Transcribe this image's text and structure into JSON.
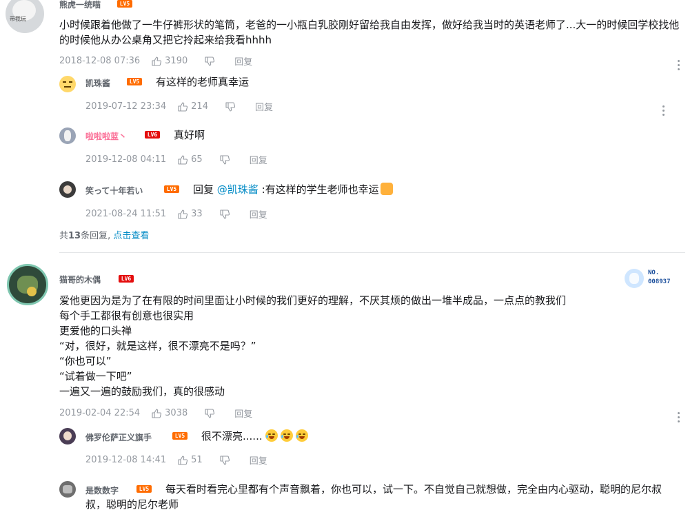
{
  "c1": {
    "username": "熊虎一统喵",
    "avatar_text": "带我玩",
    "level": "LV5",
    "text": "小时候跟着他做了一牛仔裤形状的笔筒，老爸的一小瓶白乳胶刚好留给我自由发挥，做好给我当时的英语老师了...大一的时候回学校找他的时候他从办公桌角又把它拎起来给我看hhhh",
    "date": "2018-12-08 07:36",
    "likes": "3190",
    "reply": "回复"
  },
  "c1r1": {
    "username": "凯珠酱",
    "level": "LV5",
    "text": "有这样的老师真幸运",
    "date": "2019-07-12 23:34",
    "likes": "214",
    "reply": "回复"
  },
  "c1r2": {
    "username": "啦啦啦蓝丶",
    "level": "LV6",
    "text": "真好啊",
    "date": "2019-12-08 04:11",
    "likes": "65",
    "reply": "回复"
  },
  "c1r3": {
    "username": "笑って十年若い",
    "level": "LV5",
    "prefix": "回复 ",
    "mention": "@凯珠酱",
    "text": " :有这样的学生老师也幸运",
    "date": "2021-08-24 11:51",
    "likes": "33",
    "reply": "回复"
  },
  "c1_more": {
    "pre": "共",
    "count": "13",
    "mid": "条回复, ",
    "link": "点击查看"
  },
  "c2": {
    "username": "猫哥的木偶",
    "level": "LV6",
    "badge_no": "NO.",
    "badge_num": "008937",
    "lines": [
      "爱他更因为是为了在有限的时间里面让小时候的我们更好的理解，不厌其烦的做出一堆半成品，一点点的教我们",
      "每个手工都很有创意也很实用",
      "更爱他的口头禅",
      "“对，很好，就是这样，很不漂亮不是吗？”",
      "“你也可以”",
      "“试着做一下吧”",
      "一遍又一遍的鼓励我们，真的很感动"
    ],
    "date": "2019-02-04 22:54",
    "likes": "3038",
    "reply": "回复"
  },
  "c2r1": {
    "username": "佛罗伦萨正义旗手",
    "level": "LV5",
    "text": "很不漂亮......",
    "date": "2019-12-08 14:41",
    "likes": "51",
    "reply": "回复"
  },
  "c2r2": {
    "username": "是数数字",
    "level": "LV5",
    "text": "每天看时看完心里都有个声音飘着，你也可以，试一下。不自觉自己就想做，完全由内心驱动，聪明的尼尔叔叔，聪明的尼尔老师"
  },
  "colors": {
    "accent_link": "#008ac5",
    "lv5": "#ff6c00",
    "lv6": "#e40d0d",
    "pink_name": "#fb7299"
  }
}
